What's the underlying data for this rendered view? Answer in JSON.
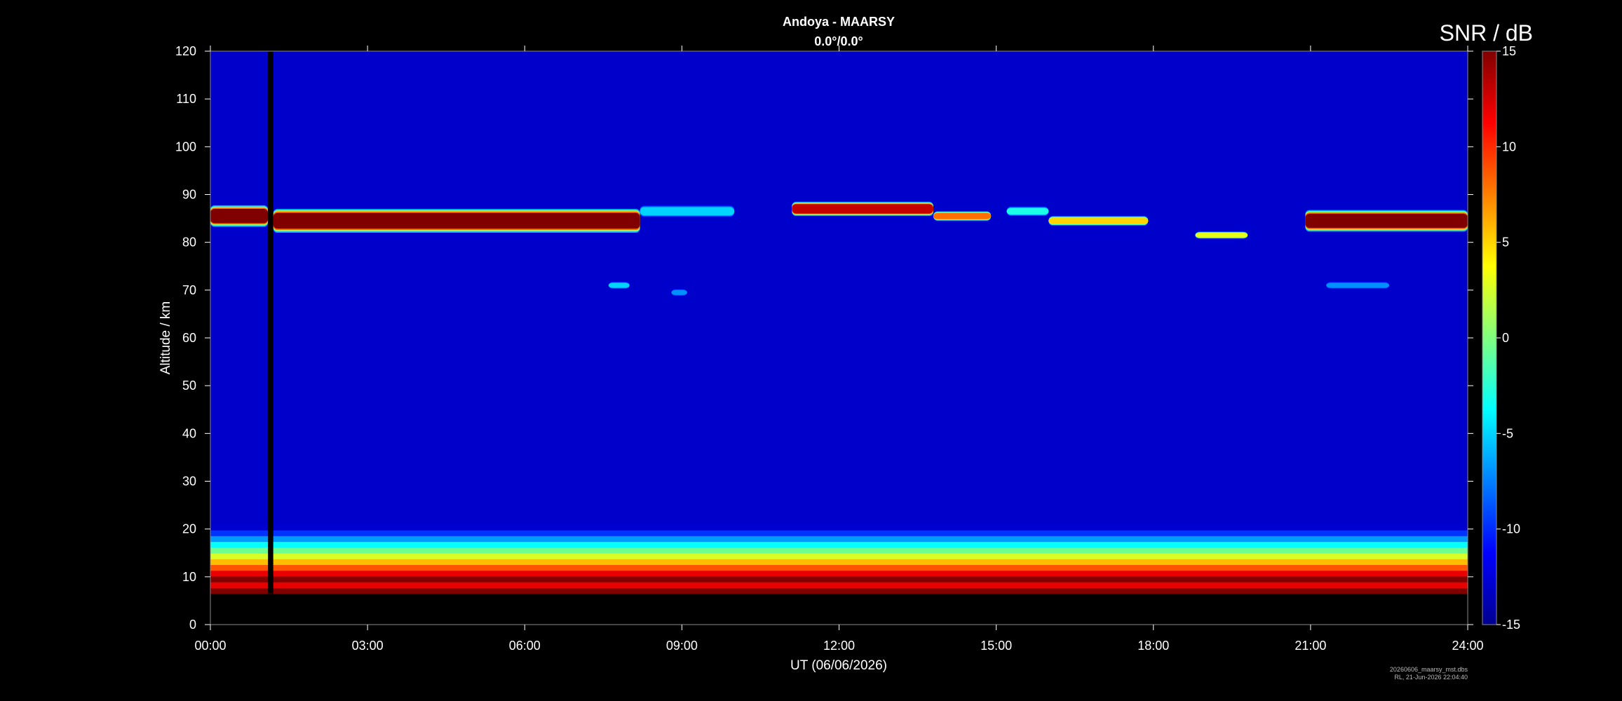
{
  "chart_data": {
    "type": "heatmap",
    "title": "Andoya - MAARSY",
    "subtitle": "0.0°/0.0°",
    "xlabel": "UT (06/06/2026)",
    "ylabel": "Altitude / km",
    "x_ticks": [
      "00:00",
      "03:00",
      "06:00",
      "09:00",
      "12:00",
      "15:00",
      "18:00",
      "21:00",
      "24:00"
    ],
    "xlim_hours": [
      0,
      24
    ],
    "y_ticks": [
      0,
      10,
      20,
      30,
      40,
      50,
      60,
      70,
      80,
      90,
      100,
      110,
      120
    ],
    "ylim_km": [
      0,
      120
    ],
    "colorbar": {
      "label": "SNR / dB",
      "range": [
        -15,
        15
      ],
      "ticks": [
        15,
        10,
        5,
        0,
        -5,
        -10,
        -15
      ],
      "colormap": "jet",
      "stops": [
        "#00008f",
        "#0000ff",
        "#00ffff",
        "#ffff00",
        "#ff0000",
        "#800000"
      ]
    },
    "background_snr_db": -13,
    "data_gap": {
      "start_hour": 1.1,
      "end_hour": 1.2
    },
    "features": {
      "pmse_echoes": [
        {
          "start_hour": 0.0,
          "end_hour": 1.1,
          "altitude_km": 85.5,
          "thickness_km": 4.5,
          "peak_snr_db": 15
        },
        {
          "start_hour": 1.2,
          "end_hour": 8.2,
          "altitude_km": 84.5,
          "thickness_km": 5.0,
          "peak_snr_db": 15
        },
        {
          "start_hour": 8.2,
          "end_hour": 10.0,
          "altitude_km": 86.5,
          "thickness_km": 2.5,
          "peak_snr_db": -5
        },
        {
          "start_hour": 11.1,
          "end_hour": 13.8,
          "altitude_km": 87.0,
          "thickness_km": 3.0,
          "peak_snr_db": 13
        },
        {
          "start_hour": 13.8,
          "end_hour": 14.9,
          "altitude_km": 85.5,
          "thickness_km": 2.0,
          "peak_snr_db": 8
        },
        {
          "start_hour": 15.2,
          "end_hour": 16.0,
          "altitude_km": 86.5,
          "thickness_km": 2.0,
          "peak_snr_db": -3
        },
        {
          "start_hour": 16.0,
          "end_hour": 17.9,
          "altitude_km": 84.5,
          "thickness_km": 2.0,
          "peak_snr_db": 5
        },
        {
          "start_hour": 18.8,
          "end_hour": 19.8,
          "altitude_km": 81.5,
          "thickness_km": 1.5,
          "peak_snr_db": 3
        },
        {
          "start_hour": 20.9,
          "end_hour": 24.0,
          "altitude_km": 84.5,
          "thickness_km": 4.5,
          "peak_snr_db": 15
        }
      ],
      "pmwe_echoes": [
        {
          "start_hour": 7.6,
          "end_hour": 8.0,
          "altitude_km": 71.0,
          "peak_snr_db": -5
        },
        {
          "start_hour": 8.8,
          "end_hour": 9.1,
          "altitude_km": 69.5,
          "peak_snr_db": -7
        },
        {
          "start_hour": 21.3,
          "end_hour": 22.5,
          "altitude_km": 71.0,
          "peak_snr_db": -7
        }
      ],
      "lower_atmosphere": {
        "bottom_km": 6.5,
        "top_km": 21.0,
        "peak_altitude_km": 9.5,
        "peak_snr_db": 15
      }
    },
    "footnote": [
      "20260606_maarsy_mst.dbs",
      "RL, 21-Jun-2026 22:04:40"
    ]
  }
}
